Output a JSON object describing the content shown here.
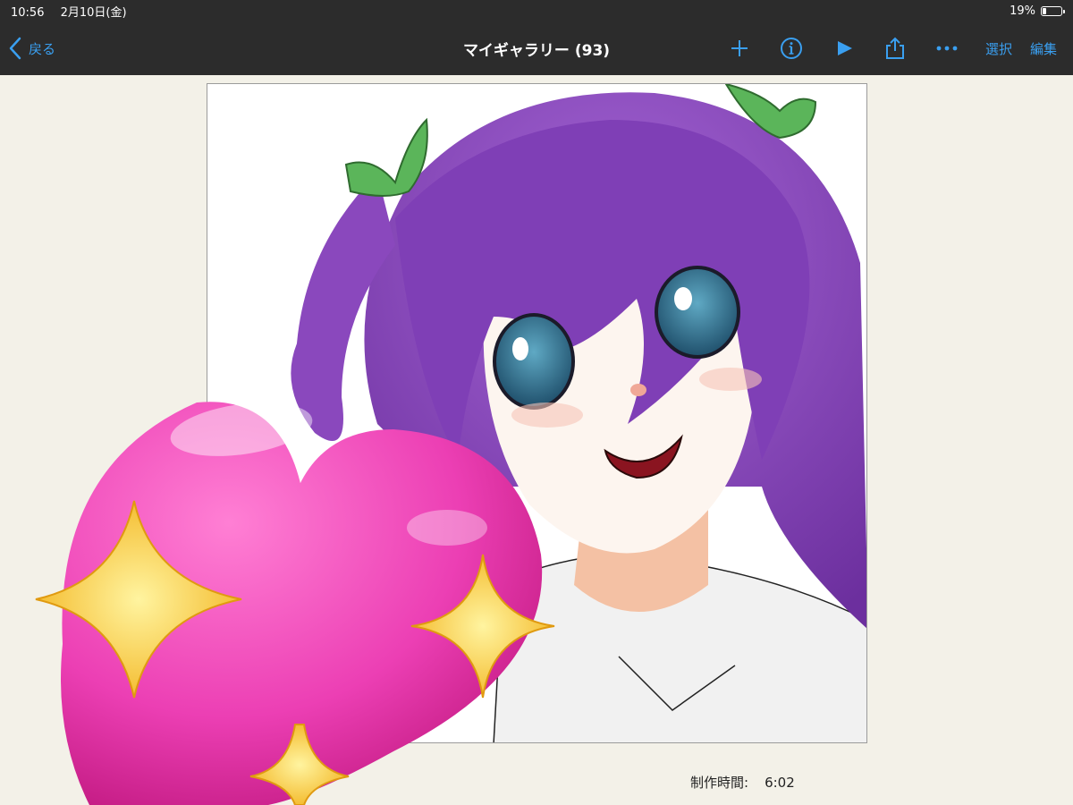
{
  "status_bar": {
    "time": "10:56",
    "date": "2月10日(金)",
    "battery": "19%",
    "battery_level": 0.19
  },
  "nav": {
    "back_label": "戻る",
    "title": "マイギャラリー (93)",
    "select_label": "選択",
    "edit_label": "編集",
    "accent_color": "#3a9ff0",
    "icons": [
      "add-icon",
      "info-icon",
      "play-icon",
      "share-icon",
      "more-icon"
    ]
  },
  "artwork": {
    "production_label": "制作時間:",
    "production_time": "6:02"
  }
}
